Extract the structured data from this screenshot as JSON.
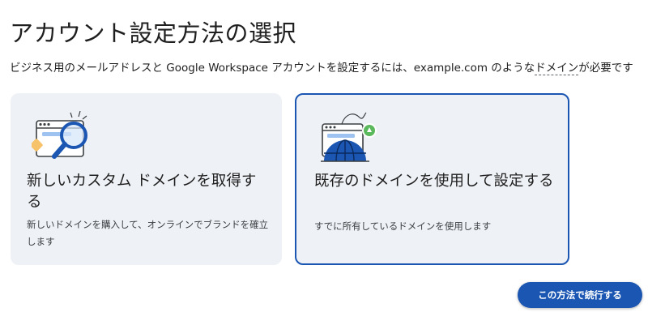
{
  "page": {
    "title": "アカウント設定方法の選択",
    "subtitle_before": "ビジネス用のメールアドレスと Google Workspace アカウントを設定するには、example.com のような",
    "subtitle_link": "ドメイン",
    "subtitle_after": "が必要です"
  },
  "options": [
    {
      "title": "新しいカスタム ドメインを取得する",
      "description": "新しいドメインを購入して、オンラインでブランドを確立します",
      "icon": "search-domain-icon",
      "selected": false
    },
    {
      "title": "既存のドメインを使用して設定する",
      "description": "すでに所有しているドメインを使用します",
      "icon": "globe-domain-icon",
      "selected": true
    }
  ],
  "actions": {
    "continue_label": "この方法で続行する"
  },
  "colors": {
    "accent": "#1b56b3",
    "card_bg": "#eef1f5"
  }
}
